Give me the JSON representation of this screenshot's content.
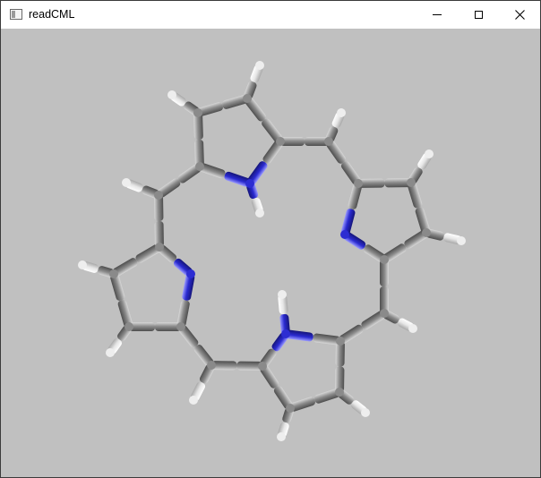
{
  "window": {
    "title": "readCML",
    "icons": {
      "app": "application-icon",
      "minimize": "minimize-icon",
      "maximize": "maximize-icon",
      "close": "close-icon"
    }
  },
  "viewport": {
    "background": "#c0c0c0",
    "colors": {
      "carbon": "#8a8a8a",
      "nitrogen": "#2d2dd2",
      "hydrogen": "#f2f2f2"
    }
  }
}
